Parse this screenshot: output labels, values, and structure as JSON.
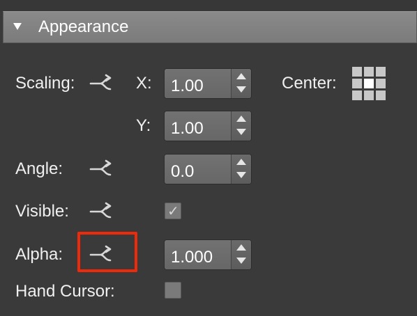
{
  "section": {
    "title": "Appearance"
  },
  "scaling": {
    "label": "Scaling:",
    "x_label": "X:",
    "x_value": "1.00",
    "y_label": "Y:",
    "y_value": "1.00",
    "center_label": "Center:",
    "center_selected": "middle"
  },
  "angle": {
    "label": "Angle:",
    "value": "0.0"
  },
  "visible": {
    "label": "Visible:",
    "checked": true,
    "check_glyph": "✓"
  },
  "alpha": {
    "label": "Alpha:",
    "value": "1.000"
  },
  "hand_cursor": {
    "label": "Hand Cursor:",
    "checked": false
  },
  "icons": {
    "link": "link-connect-icon",
    "disclosure": "disclosure-triangle-icon"
  },
  "colors": {
    "background": "#3a3a3a",
    "highlight": "#ee2a0a",
    "header": "#7f7f7f"
  }
}
